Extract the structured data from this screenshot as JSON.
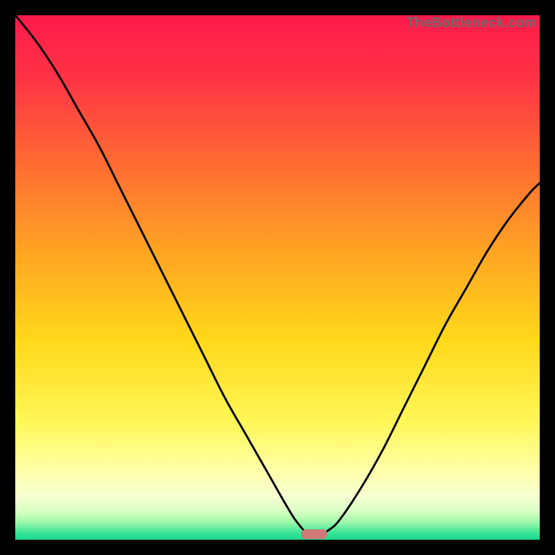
{
  "watermark": {
    "text": "TheBottleneck.com"
  },
  "colors": {
    "frame": "#000000",
    "watermark": "#6b6b6b",
    "curve_stroke": "#000000",
    "marker_fill": "#cf7a78",
    "gradient_stops": [
      {
        "offset": 0.0,
        "color": "#ff1a4b"
      },
      {
        "offset": 0.12,
        "color": "#ff3345"
      },
      {
        "offset": 0.28,
        "color": "#ff6a33"
      },
      {
        "offset": 0.45,
        "color": "#ffa423"
      },
      {
        "offset": 0.62,
        "color": "#ffd81a"
      },
      {
        "offset": 0.78,
        "color": "#fff85a"
      },
      {
        "offset": 0.875,
        "color": "#ffffb0"
      },
      {
        "offset": 0.918,
        "color": "#f6ffd2"
      },
      {
        "offset": 0.948,
        "color": "#d6ffc0"
      },
      {
        "offset": 0.968,
        "color": "#98f7a8"
      },
      {
        "offset": 0.985,
        "color": "#40e698"
      },
      {
        "offset": 1.0,
        "color": "#17d88e"
      }
    ]
  },
  "chart_data": {
    "type": "line",
    "title": "",
    "xlabel": "",
    "ylabel": "",
    "xlim": [
      0,
      100
    ],
    "ylim": [
      0,
      100
    ],
    "grid": false,
    "legend": false,
    "annotations": [
      "TheBottleneck.com"
    ],
    "marker": {
      "x_start": 54.5,
      "x_end": 59.5,
      "y": 1.0
    },
    "series": [
      {
        "name": "bottleneck-curve",
        "x": [
          0,
          4,
          8,
          12,
          16,
          20,
          24,
          28,
          32,
          36,
          40,
          44,
          48,
          52,
          54,
          56,
          58,
          60,
          62,
          66,
          70,
          74,
          78,
          82,
          86,
          90,
          94,
          98,
          100
        ],
        "y": [
          100,
          95,
          89,
          82,
          75,
          67,
          59,
          51,
          43,
          35,
          27,
          20,
          13,
          6,
          3,
          1,
          1,
          2,
          4,
          10,
          17,
          25,
          33,
          41,
          48,
          55,
          61,
          66,
          68
        ]
      }
    ]
  }
}
